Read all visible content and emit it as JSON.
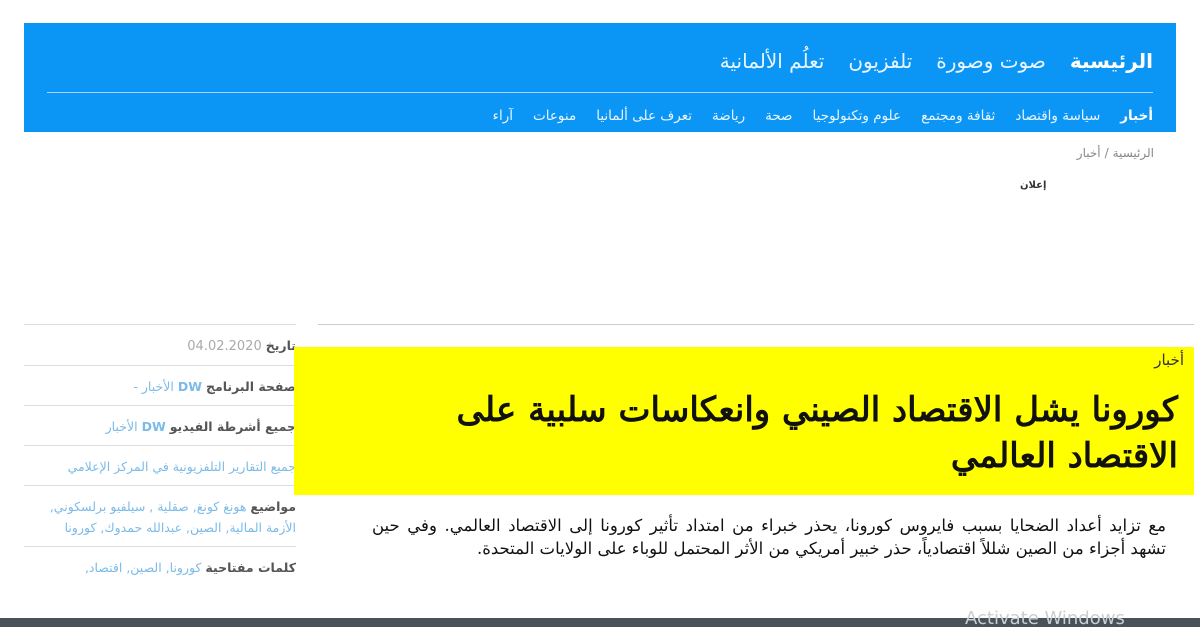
{
  "nav": {
    "primary": [
      {
        "label": "الرئيسية",
        "active": true
      },
      {
        "label": "صوت وصورة",
        "active": false
      },
      {
        "label": "تلفزيون",
        "active": false
      },
      {
        "label": "تعلُم الألمانية",
        "active": false
      }
    ],
    "secondary": [
      {
        "label": "أخبار",
        "active": true
      },
      {
        "label": "سياسة واقتصاد",
        "active": false
      },
      {
        "label": "ثقافة ومجتمع",
        "active": false
      },
      {
        "label": "علوم وتكنولوجيا",
        "active": false
      },
      {
        "label": "صحة",
        "active": false
      },
      {
        "label": "رياضة",
        "active": false
      },
      {
        "label": "تعرف على ألمانيا",
        "active": false
      },
      {
        "label": "منوعات",
        "active": false
      },
      {
        "label": "آراء",
        "active": false
      }
    ]
  },
  "breadcrumb": {
    "home": "الرئيسية",
    "separator": "/",
    "current": "أخبار"
  },
  "ad_label": "إعلان",
  "sidebar": {
    "date_label": "تاريخ",
    "date_value": "04.02.2020",
    "program_page_label": "صفحة البرنامج",
    "program_page_dw": "DW",
    "program_page_link": "الأخبار -",
    "all_videos_label": "جميع أشرطة الفيديو",
    "all_videos_dw": "DW",
    "all_videos_link": "الأخبار",
    "tv_reports_link": "جميع التقارير التلفزيونية في المركز الإعلامي",
    "topics_label": "مواضيع",
    "topics_value": "هونغ كونغ, صقلية , سيلفيو برلسكوني, الأزمة المالية, الصين, عبدالله حمدوك, كورونا",
    "keywords_label": "كلمات مفتاحية",
    "keywords_value": "كورونا, الصين, اقتصاد,"
  },
  "article": {
    "kicker": "أخبار",
    "headline": "كورونا يشل الاقتصاد الصيني وانعكاسات سلبية على الاقتصاد العالمي",
    "lead": "مع تزايد أعداد الضحايا بسبب فايروس كورونا، يحذر خبراء من امتداد تأثير كورونا إلى الاقتصاد العالمي. وفي حين تشهد أجزاء من الصين شللاً اقتصادياً، حذر خبير أمريكي من الأثر المحتمل للوباء على الولايات المتحدة."
  },
  "taskbar": {
    "watermark": "Activate Windows"
  },
  "colors": {
    "nav_blue": "#0b96f6",
    "highlight_yellow": "#ffff00",
    "link_blue": "#7bbbe8"
  }
}
